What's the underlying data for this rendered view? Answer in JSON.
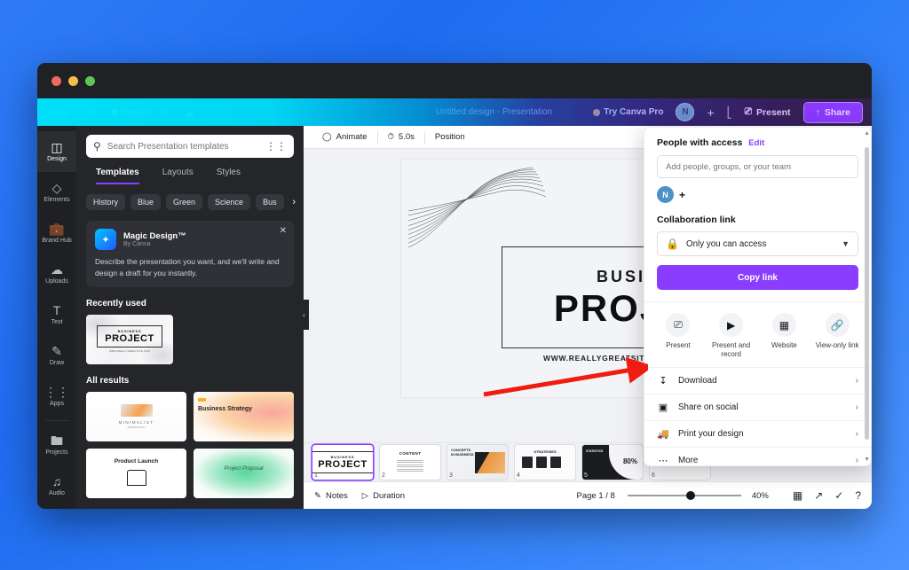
{
  "window": {
    "traffic_lights": [
      "close",
      "minimize",
      "maximize"
    ]
  },
  "topbar": {
    "home": "Home",
    "file": "File",
    "resize": "Resize",
    "undo_icon": "undo-icon",
    "cloud_icon": "cloud-edit-icon",
    "doc_title": "Untitled design - Presentation",
    "try_pro": "Try Canva Pro",
    "avatar_initial": "N",
    "add_member": "+",
    "analytics_icon": "bar-chart-icon",
    "present": "Present",
    "share": "Share"
  },
  "rail": {
    "items": [
      {
        "label": "Design",
        "icon": "layout-icon",
        "active": true
      },
      {
        "label": "Elements",
        "icon": "shapes-icon",
        "active": false
      },
      {
        "label": "Brand Hub",
        "icon": "briefcase-icon",
        "active": false
      },
      {
        "label": "Uploads",
        "icon": "cloud-upload-icon",
        "active": false
      },
      {
        "label": "Text",
        "icon": "text-icon",
        "active": false
      },
      {
        "label": "Draw",
        "icon": "pen-icon",
        "active": false
      },
      {
        "label": "Apps",
        "icon": "grid-dots-icon",
        "active": false
      },
      {
        "label": "Projects",
        "icon": "folder-icon",
        "active": false
      },
      {
        "label": "Audio",
        "icon": "music-note-icon",
        "active": false
      }
    ]
  },
  "panel": {
    "search_placeholder": "Search Presentation templates",
    "search_value": "",
    "filter_icon": "sliders-icon",
    "search_icon": "search-icon",
    "tabs": [
      {
        "label": "Templates",
        "active": true
      },
      {
        "label": "Layouts",
        "active": false
      },
      {
        "label": "Styles",
        "active": false
      }
    ],
    "chips": [
      "History",
      "Blue",
      "Green",
      "Science",
      "Bus"
    ],
    "chips_more_icon": "chevron-right-icon",
    "magic": {
      "icon": "magic-design-icon",
      "title": "Magic Design™",
      "subtitle": "By Canva",
      "body": "Describe the presentation you want, and we'll write and design a draft for you instantly.",
      "close_icon": "close-icon"
    },
    "recently_used_label": "Recently used",
    "recent_thumb": {
      "small": "BUSINESS",
      "big": "PROJECT"
    },
    "all_results_label": "All results",
    "results": [
      {
        "title": "MINIMALIST",
        "kind": "minimalist"
      },
      {
        "title": "Business Strategy",
        "kind": "strategy"
      },
      {
        "title": "Product Launch",
        "kind": "product"
      },
      {
        "title": "Project Proposal",
        "kind": "watercolor"
      }
    ]
  },
  "canvas_toolbar": {
    "animate": "Animate",
    "animate_icon": "animate-icon",
    "duration": "5.0s",
    "clock_icon": "clock-icon",
    "position": "Position"
  },
  "slide": {
    "business": "BUSINESS",
    "project": "PROJECT",
    "url": "WWW.REALLYGREATSITE.COM",
    "decoration": "wave-line-art"
  },
  "pages": [
    {
      "n": "1",
      "title": "PROJECT",
      "kicker": "BUSINESS",
      "kind": "project",
      "selected": true
    },
    {
      "n": "2",
      "title": "CONTENT",
      "kind": "content",
      "selected": false
    },
    {
      "n": "3",
      "title": "CONCEPTS IN BUSINESS",
      "kind": "concepts",
      "selected": false
    },
    {
      "n": "4",
      "title": "STRATEGIES",
      "kind": "strategies",
      "selected": false
    },
    {
      "n": "5",
      "title": "STATISTICS",
      "kind": "stats",
      "stat": "80%",
      "selected": false
    },
    {
      "n": "6",
      "title": "",
      "kind": "plain",
      "selected": false
    }
  ],
  "bottombar": {
    "notes": "Notes",
    "notes_icon": "notes-icon",
    "duration": "Duration",
    "duration_icon": "duration-icon",
    "page_indicator": "Page 1 / 8",
    "zoom_value": "40%",
    "grid_icon": "grid-view-icon",
    "fullscreen_icon": "expand-icon",
    "check_icon": "check-circle-icon",
    "help_icon": "help-circle-icon"
  },
  "share_panel": {
    "people_label": "People with access",
    "edit_link": "Edit",
    "add_placeholder": "Add people, groups, or your team",
    "add_value": "",
    "owner_initial": "N",
    "add_person_icon": "plus-icon",
    "collab_label": "Collaboration link",
    "access_value": "Only you can access",
    "lock_icon": "lock-icon",
    "chevron_icon": "chevron-down-icon",
    "copy_link": "Copy link",
    "quick_actions": [
      {
        "label": "Present",
        "icon": "present-screen-icon"
      },
      {
        "label": "Present and record",
        "icon": "video-camera-icon"
      },
      {
        "label": "Website",
        "icon": "website-icon"
      },
      {
        "label": "View-only link",
        "icon": "link-icon"
      }
    ],
    "menu": [
      {
        "label": "Download",
        "icon": "download-icon",
        "chevron": "›"
      },
      {
        "label": "Share on social",
        "icon": "social-icon",
        "chevron": "›"
      },
      {
        "label": "Print your design",
        "icon": "print-truck-icon",
        "chevron": "›"
      },
      {
        "label": "More",
        "icon": "more-dots-icon",
        "chevron": "›"
      }
    ]
  },
  "annotation": {
    "arrow_color": "#ee1c11",
    "points_to": "Download"
  }
}
